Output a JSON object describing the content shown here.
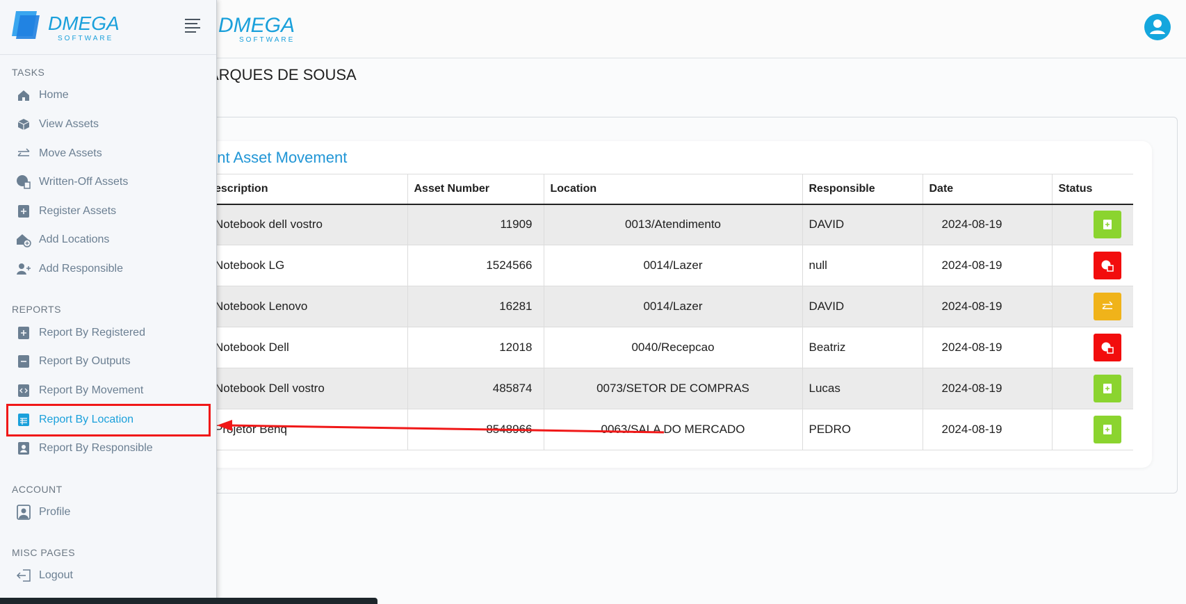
{
  "brand": {
    "name": "DMEGA",
    "tagline": "SOFTWARE",
    "accent": "#1aa0db"
  },
  "header": {
    "user_name": "ARQUES DE SOUSA"
  },
  "card": {
    "title": "ent Asset Movement"
  },
  "table": {
    "columns": [
      "escription",
      "Asset Number",
      "Location",
      "Responsible",
      "Date",
      "Status"
    ],
    "rows": [
      {
        "description": "Notebook dell vostro",
        "asset_number": "11909",
        "location": "0013/Atendimento",
        "responsible": "DAVID",
        "date": "2024-08-19",
        "status": "registered",
        "status_color": "#8bd42f"
      },
      {
        "description": "Notebook LG",
        "asset_number": "1524566",
        "location": "0014/Lazer",
        "responsible": "null",
        "date": "2024-08-19",
        "status": "written-off",
        "status_color": "#f20d0d"
      },
      {
        "description": "Notebook Lenovo",
        "asset_number": "16281",
        "location": "0014/Lazer",
        "responsible": "DAVID",
        "date": "2024-08-19",
        "status": "moved",
        "status_color": "#f0b31a"
      },
      {
        "description": "Notebook Dell",
        "asset_number": "12018",
        "location": "0040/Recepcao",
        "responsible": "Beatriz",
        "date": "2024-08-19",
        "status": "written-off",
        "status_color": "#f20d0d"
      },
      {
        "description": "Notebook Dell vostro",
        "asset_number": "485874",
        "location": "0073/SETOR DE COMPRAS",
        "responsible": "Lucas",
        "date": "2024-08-19",
        "status": "registered",
        "status_color": "#8bd42f"
      },
      {
        "description": "Projetor Benq",
        "asset_number": "8548966",
        "location": "0063/SALA DO MERCADO",
        "responsible": "PEDRO",
        "date": "2024-08-19",
        "status": "registered",
        "status_color": "#8bd42f"
      }
    ]
  },
  "sidebar": {
    "sections": {
      "tasks": "TASKS",
      "reports": "REPORTS",
      "account": "ACCOUNT",
      "misc": "MISC PAGES"
    },
    "items": [
      {
        "label": "Home",
        "icon": "home-icon"
      },
      {
        "label": "View Assets",
        "icon": "box-icon"
      },
      {
        "label": "Move Assets",
        "icon": "arrows-exchange-icon"
      },
      {
        "label": "Written-Off Assets",
        "icon": "written-off-icon"
      },
      {
        "label": "Register Assets",
        "icon": "file-plus-icon"
      },
      {
        "label": "Add Locations",
        "icon": "house-plus-icon"
      },
      {
        "label": "Add Responsible",
        "icon": "user-plus-icon"
      },
      {
        "label": "Report By Registered",
        "icon": "file-plus-icon"
      },
      {
        "label": "Report By Outputs",
        "icon": "file-minus-icon"
      },
      {
        "label": "Report By Movement",
        "icon": "file-code-icon"
      },
      {
        "label": "Report By Location",
        "icon": "file-list-icon",
        "active": true
      },
      {
        "label": "Report By Responsible",
        "icon": "file-person-icon"
      },
      {
        "label": "Profile",
        "icon": "profile-icon"
      },
      {
        "label": "Logout",
        "icon": "logout-icon"
      }
    ]
  },
  "annotation": {
    "color": "#f01818"
  }
}
